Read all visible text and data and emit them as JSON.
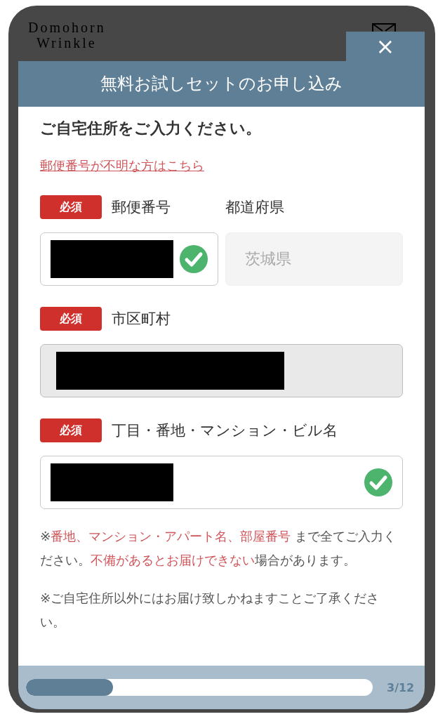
{
  "header": {
    "logo_lines": [
      "Domohorn",
      "Wrinkle"
    ]
  },
  "modal": {
    "close_label": "×",
    "title": "無料お試しセットのお申し込み"
  },
  "form": {
    "heading": "ご自宅住所をご入力ください。",
    "help_link": "郵便番号が不明な方はこちら",
    "rows": [
      {
        "fields": [
          {
            "kind": "postal",
            "label": "郵便番号",
            "required": true,
            "required_label": "必須",
            "redacted": true,
            "valid": true,
            "disabled": false
          },
          {
            "kind": "prefecture",
            "label": "都道府県",
            "required": false,
            "value": "茨城県",
            "redacted": false,
            "valid": false,
            "disabled": true
          }
        ]
      },
      {
        "fields": [
          {
            "kind": "city",
            "label": "市区町村",
            "required": true,
            "required_label": "必須",
            "redacted": true,
            "valid": false,
            "disabled": true
          }
        ]
      },
      {
        "fields": [
          {
            "kind": "address",
            "label": "丁目・番地・マンション・ビル名",
            "required": true,
            "required_label": "必須",
            "redacted": true,
            "valid": true,
            "disabled": false
          }
        ]
      }
    ],
    "notes": [
      [
        {
          "text": "※",
          "emphasis": false
        },
        {
          "text": "番地、マンション・アパート名、部屋番号",
          "emphasis": true
        },
        {
          "text": " まで全てご入力ください。",
          "emphasis": false
        },
        {
          "text": "不備があるとお届けできない",
          "emphasis": true
        },
        {
          "text": "場合があります。",
          "emphasis": false
        }
      ],
      [
        {
          "text": "※ご自宅住所以外にはお届け致しかねますことご了承ください。",
          "emphasis": false
        }
      ]
    ]
  },
  "progress": {
    "level": 0.25,
    "reading": "3/12"
  }
}
